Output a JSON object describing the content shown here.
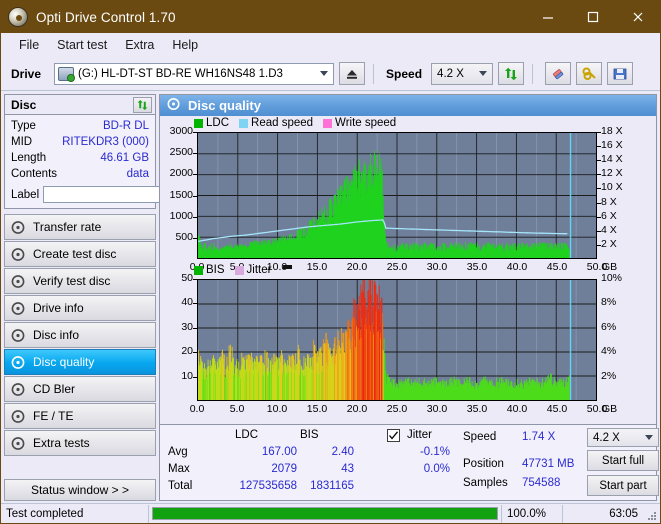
{
  "window": {
    "title": "Opti Drive Control 1.70",
    "icon": "disc-icon",
    "minimize": "minimize-icon",
    "maximize": "maximize-icon",
    "close": "close-icon",
    "titlebar_color": "#6b4a12"
  },
  "menu": {
    "items": [
      {
        "label": "File"
      },
      {
        "label": "Start test"
      },
      {
        "label": "Extra"
      },
      {
        "label": "Help"
      }
    ]
  },
  "toolbar": {
    "drive_label": "Drive",
    "drive_value": "(G:)   HL-DT-ST BD-RE  WH16NS48 1.D3",
    "eject_icon": "eject-icon",
    "speed_label": "Speed",
    "speed_value": "4.2 X",
    "refresh_icon": "refresh-icon",
    "erase_icon": "eraser-icon",
    "tools_icon": "tools-icon",
    "save_icon": "save-icon"
  },
  "sidebar": {
    "disc_panel": {
      "title": "Disc",
      "refresh_icon": "refresh-icon",
      "rows": [
        {
          "key": "Type",
          "value": "BD-R DL"
        },
        {
          "key": "MID",
          "value": "RITEKDR3 (000)"
        },
        {
          "key": "Length",
          "value": "46.61 GB"
        },
        {
          "key": "Contents",
          "value": "data"
        }
      ],
      "label_key": "Label",
      "label_value": "",
      "label_placeholder": "",
      "disc_icon": "disc-label-icon"
    },
    "nav": [
      {
        "label": "Transfer rate",
        "icon": "disc-icon",
        "active": false
      },
      {
        "label": "Create test disc",
        "icon": "disc-icon",
        "active": false
      },
      {
        "label": "Verify test disc",
        "icon": "disc-icon",
        "active": false
      },
      {
        "label": "Drive info",
        "icon": "disc-icon",
        "active": false
      },
      {
        "label": "Disc info",
        "icon": "disc-icon",
        "active": false
      },
      {
        "label": "Disc quality",
        "icon": "disc-icon",
        "active": true
      },
      {
        "label": "CD Bler",
        "icon": "disc-icon",
        "active": false
      },
      {
        "label": "FE / TE",
        "icon": "disc-icon",
        "active": false
      },
      {
        "label": "Extra tests",
        "icon": "disc-icon",
        "active": false
      }
    ],
    "status_button": "Status window > >"
  },
  "main": {
    "header_title": "Disc quality",
    "header_icon": "disc-icon"
  },
  "stats": {
    "col_ldc": "LDC",
    "col_bis": "BIS",
    "jitter_label": "Jitter",
    "jitter_checked": true,
    "rows": [
      {
        "name": "Avg",
        "ldc": "167.00",
        "bis": "2.40",
        "jitter": "-0.1%"
      },
      {
        "name": "Max",
        "ldc": "2079",
        "bis": "43",
        "jitter": "0.0%"
      },
      {
        "name": "Total",
        "ldc": "127535658",
        "bis": "1831165",
        "jitter": ""
      }
    ],
    "speed_key": "Speed",
    "speed_value": "1.74 X",
    "position_key": "Position",
    "position_value": "47731 MB",
    "samples_key": "Samples",
    "samples_value": "754588",
    "speed_select_value": "4.2 X",
    "start_full": "Start full",
    "start_part": "Start part"
  },
  "statusbar": {
    "message": "Test completed",
    "percent_label": "100.0%",
    "percent_value": 100,
    "time": "63:05"
  },
  "chart_data": [
    {
      "type": "line",
      "name": "ldc-chart",
      "title": "",
      "legend": [
        {
          "label": "LDC",
          "color": "#00b400"
        },
        {
          "label": "Read speed",
          "color": "#7fd4f4"
        },
        {
          "label": "Write speed",
          "color": "#ff72d5"
        }
      ],
      "legend_position": "top-left",
      "xlabel": "GB",
      "xlim": [
        0,
        50
      ],
      "xticks": [
        "0.0",
        "5.0",
        "10.0",
        "15.0",
        "20.0",
        "25.0",
        "30.0",
        "35.0",
        "40.0",
        "45.0",
        "50.0"
      ],
      "ylabel_left": "",
      "ylim_left": [
        0,
        3000
      ],
      "yticks_left": [
        "500",
        "1000",
        "1500",
        "2000",
        "2500",
        "3000"
      ],
      "ylabel_right": "X",
      "ylim_right": [
        0,
        18
      ],
      "yticks_right": [
        "2 X",
        "4 X",
        "6 X",
        "8 X",
        "10 X",
        "12 X",
        "14 X",
        "16 X",
        "18 X"
      ],
      "grid": true,
      "data_end_gb": 46.6,
      "series": [
        {
          "name": "LDC",
          "color": "#00c800",
          "type": "area",
          "x": [
            0.0,
            0.5,
            1.0,
            1.5,
            2.0,
            2.5,
            3.0,
            3.5,
            4.0,
            4.5,
            5.0,
            5.5,
            6.0,
            6.5,
            7.0,
            7.5,
            8.0,
            8.5,
            9.0,
            9.5,
            10.0,
            10.5,
            11.0,
            11.5,
            12.0,
            12.5,
            13.0,
            13.5,
            14.0,
            14.5,
            15.0,
            15.5,
            16.0,
            16.5,
            17.0,
            17.5,
            18.0,
            18.5,
            19.0,
            19.5,
            20.0,
            20.5,
            21.0,
            21.5,
            22.0,
            22.5,
            23.0,
            23.2,
            23.4,
            23.6,
            24.0,
            25.0,
            26.0,
            27.0,
            28.0,
            29.0,
            30.0,
            31.0,
            32.0,
            33.0,
            34.0,
            35.0,
            36.0,
            37.0,
            38.0,
            39.0,
            40.0,
            41.0,
            42.0,
            43.0,
            44.0,
            45.0,
            46.0,
            46.6
          ],
          "values": [
            450,
            200,
            170,
            180,
            200,
            190,
            210,
            230,
            260,
            240,
            250,
            270,
            260,
            300,
            330,
            300,
            320,
            350,
            330,
            360,
            380,
            400,
            420,
            450,
            480,
            520,
            560,
            620,
            690,
            740,
            820,
            900,
            980,
            1080,
            1180,
            1290,
            1380,
            1480,
            1590,
            1680,
            1760,
            1820,
            1880,
            1940,
            1980,
            1920,
            1900,
            1300,
            600,
            250,
            230,
            210,
            260,
            240,
            230,
            250,
            240,
            220,
            260,
            230,
            250,
            240,
            230,
            260,
            240,
            230,
            250,
            240,
            230,
            250,
            240,
            230,
            250,
            240
          ]
        },
        {
          "name": "Read speed",
          "color": "#8fdcf8",
          "type": "line",
          "x": [
            0.0,
            2.0,
            4.0,
            6.0,
            8.0,
            10.0,
            12.0,
            14.0,
            16.0,
            18.0,
            20.0,
            22.0,
            23.3,
            23.6,
            26.0,
            30.0,
            34.0,
            38.0,
            42.0,
            46.0,
            46.6
          ],
          "values": [
            2.4,
            2.8,
            3.1,
            3.3,
            3.6,
            3.9,
            4.2,
            4.5,
            4.7,
            4.9,
            5.2,
            5.4,
            5.5,
            4.3,
            4.2,
            4.05,
            3.9,
            3.75,
            3.6,
            3.5,
            3.5
          ]
        }
      ],
      "marker_line_gb": 46.8,
      "marker_color": "#5fd6f5"
    },
    {
      "type": "bar",
      "name": "bis-chart",
      "title": "",
      "legend": [
        {
          "label": "BIS",
          "color": "#00b400"
        },
        {
          "label": "Jitter",
          "color": "#d9a8dd"
        }
      ],
      "legend_position": "top-left",
      "xlabel": "GB",
      "xlim": [
        0,
        50
      ],
      "xticks": [
        "0.0",
        "5.0",
        "10.0",
        "15.0",
        "20.0",
        "25.0",
        "30.0",
        "35.0",
        "40.0",
        "45.0",
        "50.0"
      ],
      "ylim_left": [
        0,
        50
      ],
      "yticks_left": [
        "10",
        "20",
        "30",
        "40",
        "50"
      ],
      "ylim_right": [
        0,
        10
      ],
      "yticks_right": [
        "2%",
        "4%",
        "6%",
        "8%",
        "10%"
      ],
      "grid": true,
      "data_end_gb": 46.6,
      "series": [
        {
          "name": "BIS",
          "x": [
            0.0,
            0.5,
            1.0,
            1.5,
            2.0,
            2.5,
            3.0,
            3.5,
            4.0,
            4.5,
            5.0,
            5.5,
            6.0,
            6.5,
            7.0,
            7.5,
            8.0,
            8.5,
            9.0,
            9.5,
            10.0,
            10.5,
            11.0,
            11.5,
            12.0,
            12.5,
            13.0,
            13.5,
            14.0,
            14.5,
            15.0,
            15.5,
            16.0,
            16.5,
            17.0,
            17.5,
            18.0,
            18.5,
            19.0,
            19.5,
            20.0,
            20.5,
            21.0,
            21.5,
            22.0,
            22.5,
            23.0,
            23.3,
            23.6,
            24.0,
            25.0,
            26.0,
            27.0,
            28.0,
            29.0,
            30.0,
            31.0,
            32.0,
            33.0,
            34.0,
            35.0,
            36.0,
            37.0,
            38.0,
            39.0,
            40.0,
            41.0,
            42.0,
            43.0,
            44.0,
            45.0,
            46.0,
            46.6
          ],
          "values": [
            15,
            11,
            12,
            13,
            14,
            13,
            16,
            12,
            18,
            13,
            12,
            14,
            13,
            15,
            12,
            14,
            13,
            16,
            12,
            14,
            13,
            15,
            12,
            14,
            13,
            17,
            12,
            14,
            13,
            18,
            15,
            16,
            20,
            17,
            19,
            22,
            21,
            24,
            23,
            30,
            31,
            35,
            40,
            43,
            38,
            35,
            32,
            20,
            8,
            7,
            6,
            7,
            6,
            7,
            6,
            7,
            6,
            7,
            6,
            7,
            6,
            7,
            6,
            7,
            6,
            7,
            6,
            7,
            6,
            9,
            6,
            7,
            8
          ]
        }
      ],
      "marker_line_gb": 46.8,
      "marker_color": "#5fd6f5"
    }
  ]
}
